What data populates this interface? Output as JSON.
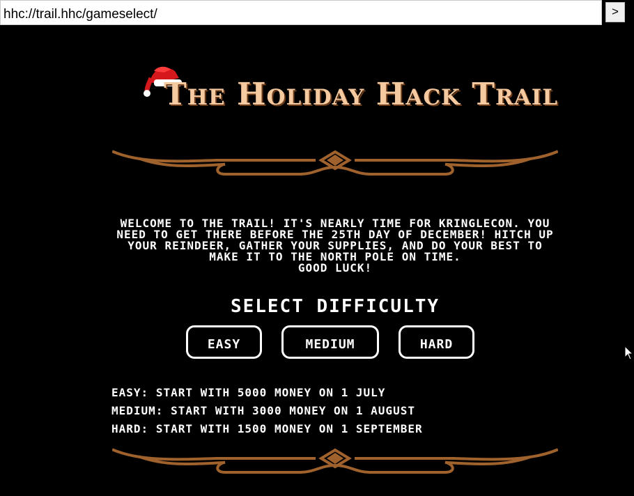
{
  "address_bar": {
    "url": "hhc://trail.hhc/gameselect/",
    "go_label": ">"
  },
  "header": {
    "title": "The Holiday Hack Trail",
    "hat_icon": "santa-hat-icon"
  },
  "intro": {
    "text": "Welcome to the trail! It's nearly time for KringleCon. You need to get there before the 25th day of December! Hitch up your reindeer, gather your supplies, and do your best to make it to the North Pole on time.",
    "closing": "Good luck!"
  },
  "difficulty": {
    "heading": "Select Difficulty",
    "buttons": [
      {
        "label": "Easy"
      },
      {
        "label": "Medium"
      },
      {
        "label": "Hard"
      }
    ]
  },
  "descriptions": [
    {
      "level": "EASY:",
      "text": "Start with 5000 money on 1 July"
    },
    {
      "level": "MEDIUM:",
      "text": "Start with 3000 money on 1 August"
    },
    {
      "level": "HARD:",
      "text": "Start with 1500 money on 1 September"
    }
  ],
  "colors": {
    "background": "#000000",
    "title": "#f6caa0",
    "ornament": "#a0622c",
    "text": "#ffffff"
  }
}
